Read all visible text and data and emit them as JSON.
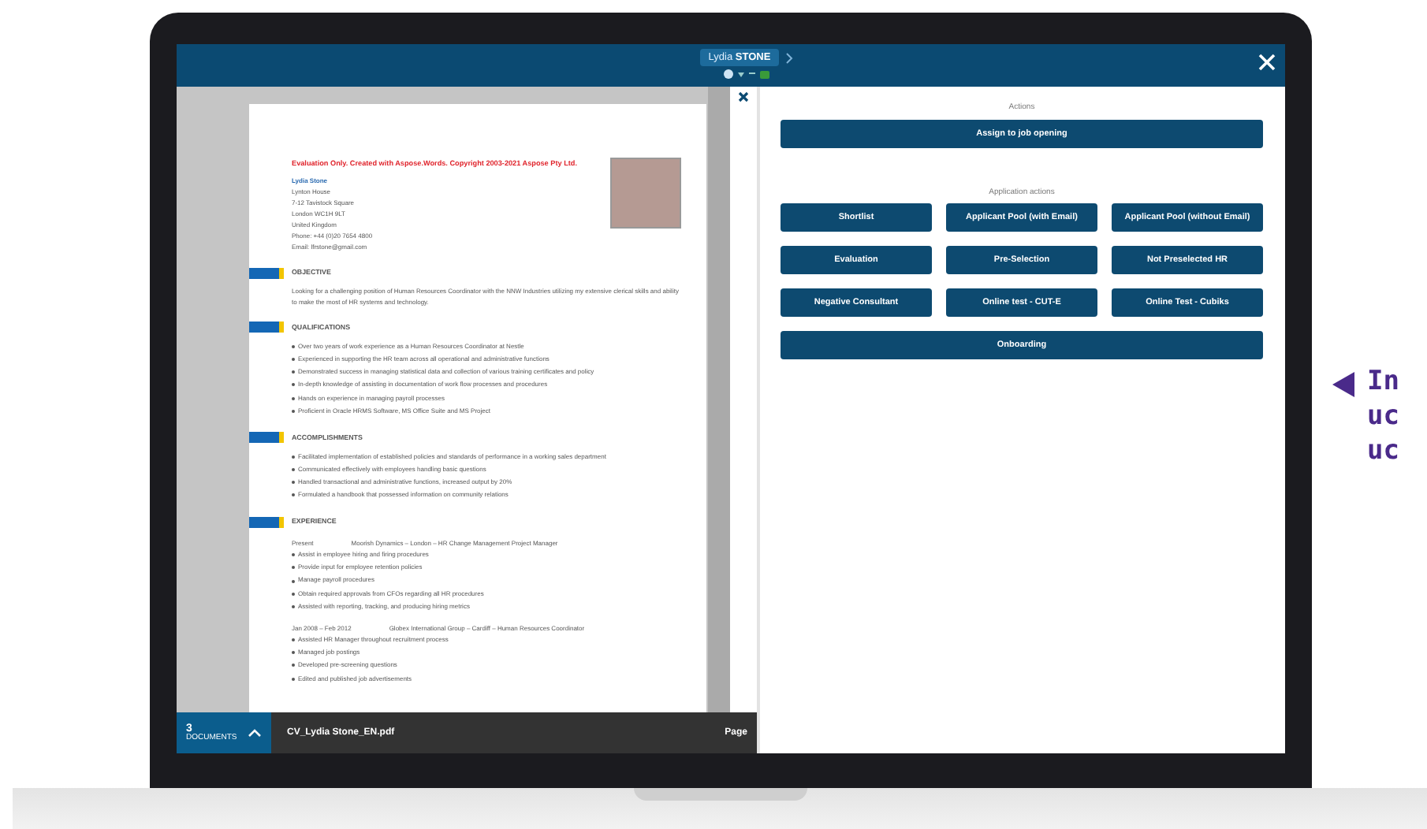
{
  "screen": {
    "header": {
      "candidate_name": "Lydia **STONE**"
    },
    "document": {
      "notice": "Evaluation Only. Created with Aspose.Words. Copyright 2003-2021 Aspose Pty Ltd.",
      "name": "Lydia Stone",
      "contact_lines": [
        "Lynton House",
        "7-12 Tavistock Square",
        "London WC1H 9LT",
        "United Kingdom",
        "Phone: +44 (0)20 7654 4800",
        "Email: lfrstone@gmail.com"
      ],
      "sections": [
        {
          "heading": "OBJECTIVE",
          "kind": "paragraph",
          "text": "Looking for a challenging position of Human Resources Coordinator with the NNW Industries utilizing my extensive clerical skills and ability to make the most of HR systems and technology."
        },
        {
          "heading": "QUALIFICATIONS",
          "kind": "bullets",
          "items": [
            "Over two years of work experience as a Human Resources Coordinator at Nestle",
            "Experienced in supporting the HR team across all operational and administrative functions",
            "Demonstrated success in managing statistical data and collection of various training certificates and policy",
            "In-depth knowledge of assisting in documentation of work flow processes and procedures",
            "Hands on experience in managing payroll processes",
            "Proficient in Oracle HRMS Software, MS Office Suite and MS Project"
          ]
        },
        {
          "heading": "ACCOMPLISHMENTS",
          "kind": "bullets",
          "items": [
            "Facilitated implementation of established policies and standards of performance in a working sales department",
            "Communicated effectively with employees handling basic questions",
            "Handled transactional and administrative functions, increased output by 20%",
            "Formulated a handbook that possessed information on community relations"
          ]
        },
        {
          "heading": "EXPERIENCE",
          "kind": "jobs",
          "jobs": [
            {
              "period": "Present",
              "title": "Moorish Dynamics – London – HR Change Management Project Manager",
              "items": [
                "Assist in employee hiring and firing procedures",
                "Provide input for employee retention policies",
                "Manage payroll procedures",
                "Obtain required approvals from CFOs regarding all HR procedures",
                "Assisted with reporting, tracking, and producing hiring metrics"
              ]
            },
            {
              "period": "Jan 2008 – Feb 2012",
              "title": "Globex International Group – Cardiff – Human Resources Coordinator",
              "items": [
                "Assisted HR Manager throughout recruitment process",
                "Managed job postings",
                "Developed pre-screening questions",
                "Edited and published job advertisements"
              ]
            }
          ]
        }
      ]
    },
    "document_bar": {
      "count": "3",
      "count_label": "DOCUMENTS",
      "file_name": "CV_Lydia Stone_EN.pdf",
      "page_label": "Page"
    },
    "actions": {
      "title": "Actions",
      "primary_button": "Assign to job opening",
      "section_title": "Application actions",
      "buttons": [
        "Shortlist",
        "Applicant Pool (with Email)",
        "Applicant Pool (without Email)",
        "Evaluation",
        "Pre-Selection",
        "Not Preselected HR",
        "Negative Consultant",
        "Online test - CUT-E",
        "Online Test - Cubiks"
      ],
      "wide_button": "Onboarding"
    }
  },
  "annotation": {
    "lines": [
      "In",
      "uc",
      "uc"
    ]
  }
}
